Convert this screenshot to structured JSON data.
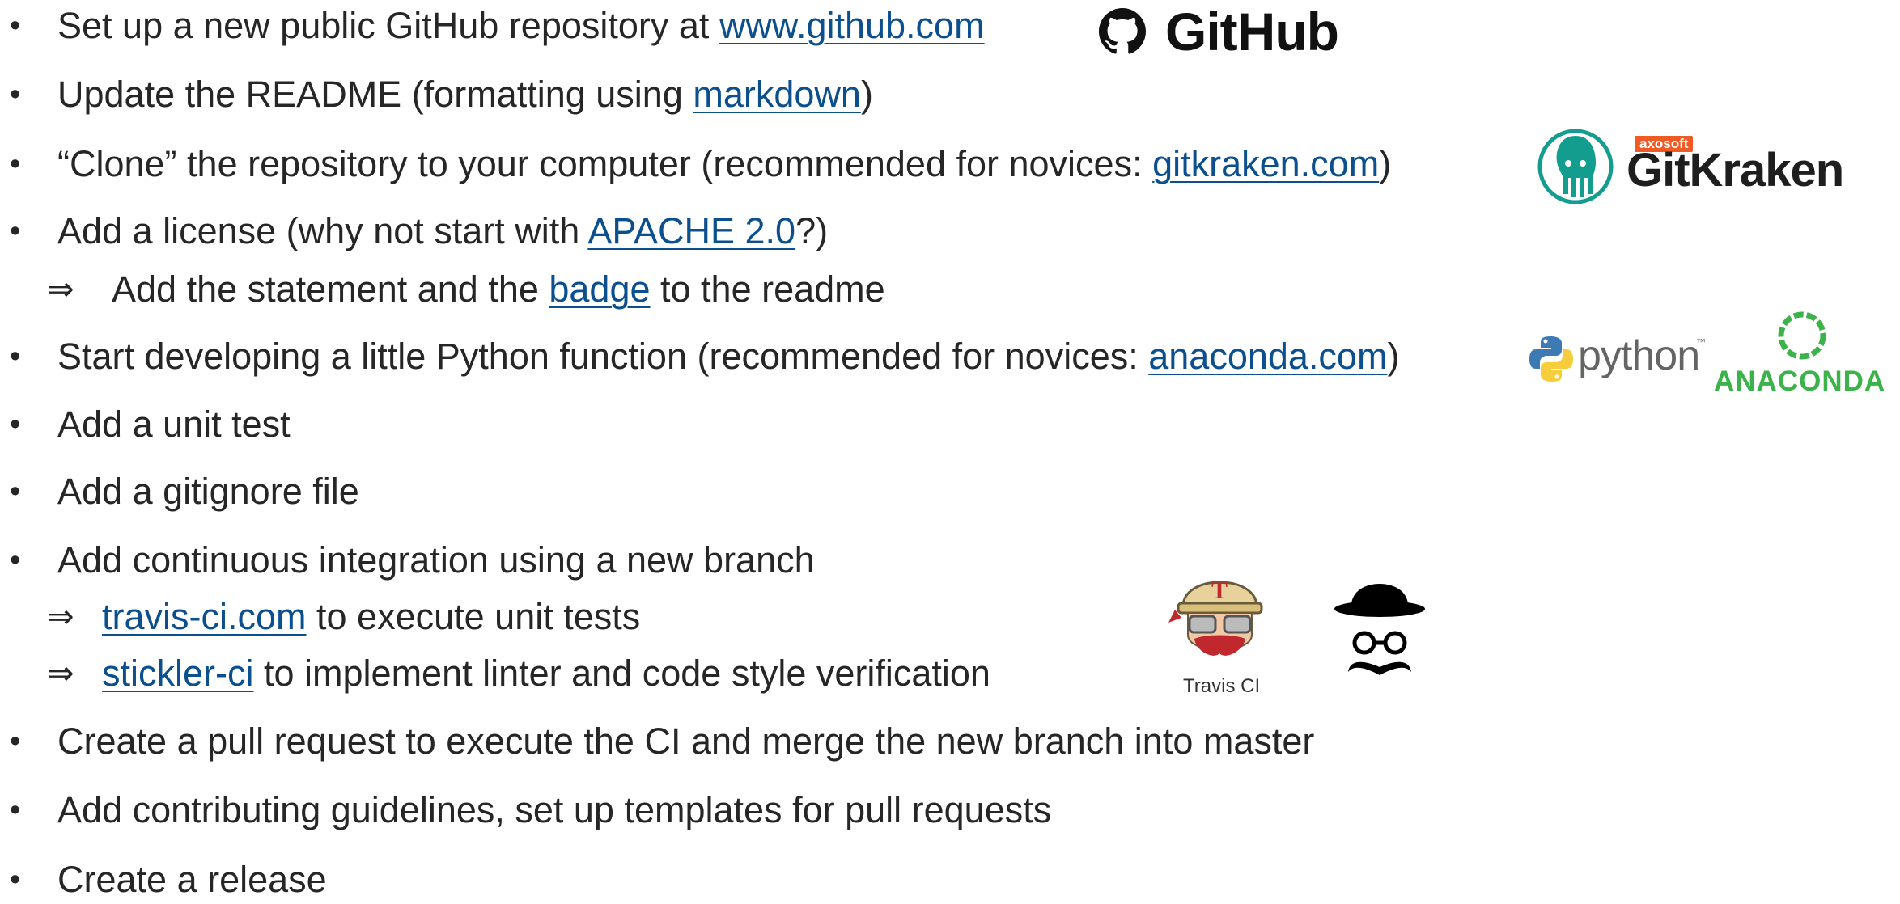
{
  "items": [
    {
      "bullet": "•",
      "text": "Set up a new public GitHub repository at ",
      "link": "www.github.com",
      "after": ""
    },
    {
      "bullet": "•",
      "text": "Update the README (formatting using ",
      "link": "markdown",
      "after": ")"
    },
    {
      "bullet": "•",
      "text": "“Clone” the repository to your computer (recommended for novices: ",
      "link": "gitkraken.com",
      "after": ")"
    },
    {
      "bullet": "•",
      "text": "Add a license (why not start with ",
      "link": "APACHE 2.0",
      "after": "?)"
    },
    {
      "arrow": "⇒",
      "text": "Add the statement and the ",
      "link": "badge",
      "after": " to the readme"
    },
    {
      "bullet": "•",
      "text": "Start developing a little Python function (recommended for novices: ",
      "link": "anaconda.com",
      "after": ")"
    },
    {
      "bullet": "•",
      "text": "Add a unit test"
    },
    {
      "bullet": "•",
      "text": "Add a gitignore file"
    },
    {
      "bullet": "•",
      "text": "Add continuous integration using a new branch"
    },
    {
      "arrow": "⇒",
      "link": "travis-ci.com",
      "after": " to execute unit tests"
    },
    {
      "arrow": "⇒",
      "link": "stickler-ci",
      "after": " to implement linter and code style verification"
    },
    {
      "bullet": "•",
      "text": "Create a pull request to execute the CI and merge the new branch into master"
    },
    {
      "bullet": "•",
      "text": "Add contributing guidelines, set up templates for pull requests"
    },
    {
      "bullet": "•",
      "text": "Create a release"
    }
  ],
  "logos": {
    "github": {
      "icon": "github-octocat-icon",
      "word": "GitHub"
    },
    "gitkraken": {
      "icon": "gitkraken-squid-icon",
      "tag": "axosoft",
      "word": "GitKraken",
      "color": "#139d8f"
    },
    "python": {
      "icon": "python-snakes-icon",
      "word": "python",
      "tm": "™"
    },
    "anaconda": {
      "icon": "anaconda-ring-icon",
      "word": "ANACONDA",
      "color": "#3cb34a"
    },
    "travis": {
      "icon": "travis-mascot-icon",
      "word": "Travis CI"
    },
    "stickler": {
      "icon": "stickler-hat-glasses-mustache-icon"
    }
  },
  "colors": {
    "text": "#262626",
    "link": "#0b4f8f"
  }
}
